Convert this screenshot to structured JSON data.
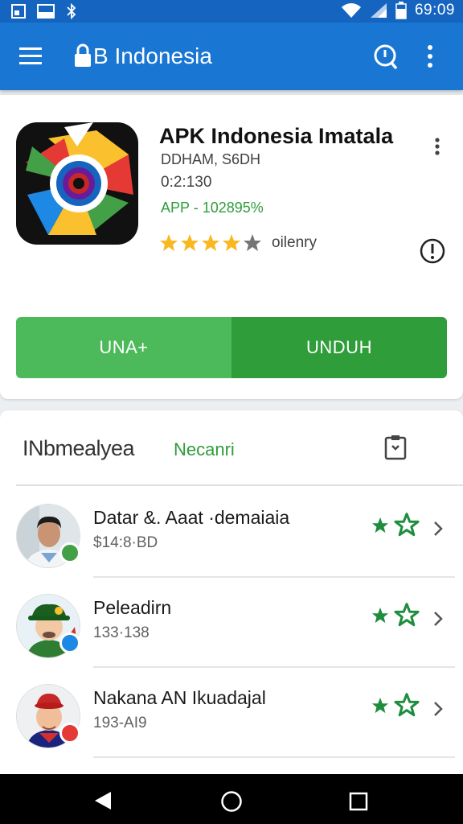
{
  "status_bar": {
    "time": "69:09",
    "icons": [
      "image-icon",
      "screen-icon",
      "bluetooth-icon",
      "wifi-icon",
      "signal-icon",
      "battery-icon"
    ]
  },
  "app_bar": {
    "title": "B Indonesia",
    "icons": [
      "menu-icon",
      "lock-icon",
      "search-icon",
      "more-vert-icon"
    ]
  },
  "app": {
    "name": "APK Indonesia  Imatala",
    "developer": "DDHAM, S6DH",
    "version": "0:2:130",
    "tag": "APP - 102895%",
    "rating": 4,
    "rating_max": 5,
    "rating_label": "oilenry",
    "buttons": {
      "secondary": "UNA+",
      "primary": "UNDUH"
    }
  },
  "section": {
    "title": "INbmealyea",
    "tab": "Necanri"
  },
  "list": [
    {
      "name": "Datar &. Aaat ·demaiaia",
      "sub": "$14:8·BD",
      "badge_color": "#43a047"
    },
    {
      "name": "Peleadirn",
      "sub": "133·138",
      "badge_color": "#1e88e5"
    },
    {
      "name": "Nakana AN Ikuadajal",
      "sub": "193-AI9",
      "badge_color": "#e53935"
    }
  ],
  "colors": {
    "app_bar": "#1976d2",
    "status_bar": "#1565c0",
    "green_primary": "#2e9d3a",
    "green_light": "#4cb95a"
  },
  "nav": {
    "icons": [
      "back-icon",
      "home-icon",
      "recents-icon"
    ]
  }
}
